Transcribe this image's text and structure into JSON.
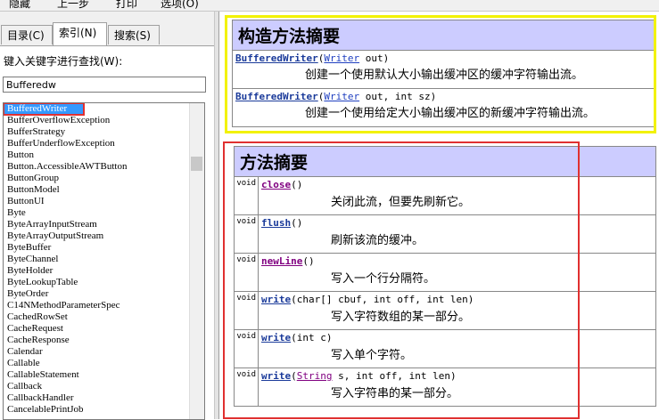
{
  "menu": {
    "items": [
      "隐藏",
      "上一步",
      "打印",
      "选项(O)"
    ]
  },
  "tabs": [
    {
      "label": "目录(C)",
      "active": false
    },
    {
      "label": "索引(N)",
      "active": true
    },
    {
      "label": "搜索(S)",
      "active": false
    }
  ],
  "index": {
    "label": "键入关键字进行查找(W):",
    "input_value": "Bufferedw",
    "items": [
      "BufferedWriter",
      "BufferOverflowException",
      "BufferStrategy",
      "BufferUnderflowException",
      "Button",
      "Button.AccessibleAWTButton",
      "ButtonGroup",
      "ButtonModel",
      "ButtonUI",
      "Byte",
      "ByteArrayInputStream",
      "ByteArrayOutputStream",
      "ByteBuffer",
      "ByteChannel",
      "ByteHolder",
      "ByteLookupTable",
      "ByteOrder",
      "C14NMethodParameterSpec",
      "CachedRowSet",
      "CacheRequest",
      "CacheResponse",
      "Calendar",
      "Callable",
      "CallableStatement",
      "Callback",
      "CallbackHandler",
      "CancelablePrintJob"
    ],
    "selected_index": 0
  },
  "constructors": {
    "title": "构造方法摘要",
    "rows": [
      {
        "name": "BufferedWriter",
        "params_prefix": "(",
        "param_link": "Writer",
        "params_rest": " out)",
        "desc": "创建一个使用默认大小输出缓冲区的缓冲字符输出流。"
      },
      {
        "name": "BufferedWriter",
        "params_prefix": "(",
        "param_link": "Writer",
        "params_rest": " out, int sz)",
        "desc": "创建一个使用给定大小输出缓冲区的新缓冲字符输出流。"
      }
    ]
  },
  "methods": {
    "title": "方法摘要",
    "rows": [
      {
        "type": "void",
        "name": "close",
        "params_prefix": "()",
        "param_link": "",
        "params_rest": "",
        "desc": "关闭此流，但要先刷新它。"
      },
      {
        "type": "void",
        "name": "flush",
        "params_prefix": "()",
        "param_link": "",
        "params_rest": "",
        "desc": "刷新该流的缓冲。"
      },
      {
        "type": "void",
        "name": "newLine",
        "params_prefix": "()",
        "param_link": "",
        "params_rest": "",
        "desc": "写入一个行分隔符。"
      },
      {
        "type": "void",
        "name": "write",
        "params_prefix": "(char[] cbuf, int off, int len)",
        "param_link": "",
        "params_rest": "",
        "desc": "写入字符数组的某一部分。"
      },
      {
        "type": "void",
        "name": "write",
        "params_prefix": "(int c)",
        "param_link": "",
        "params_rest": "",
        "desc": "写入单个字符。"
      },
      {
        "type": "void",
        "name": "write",
        "params_prefix": "(",
        "param_link": "String",
        "params_rest": " s, int off, int len)",
        "desc": "写入字符串的某一部分。"
      }
    ]
  }
}
